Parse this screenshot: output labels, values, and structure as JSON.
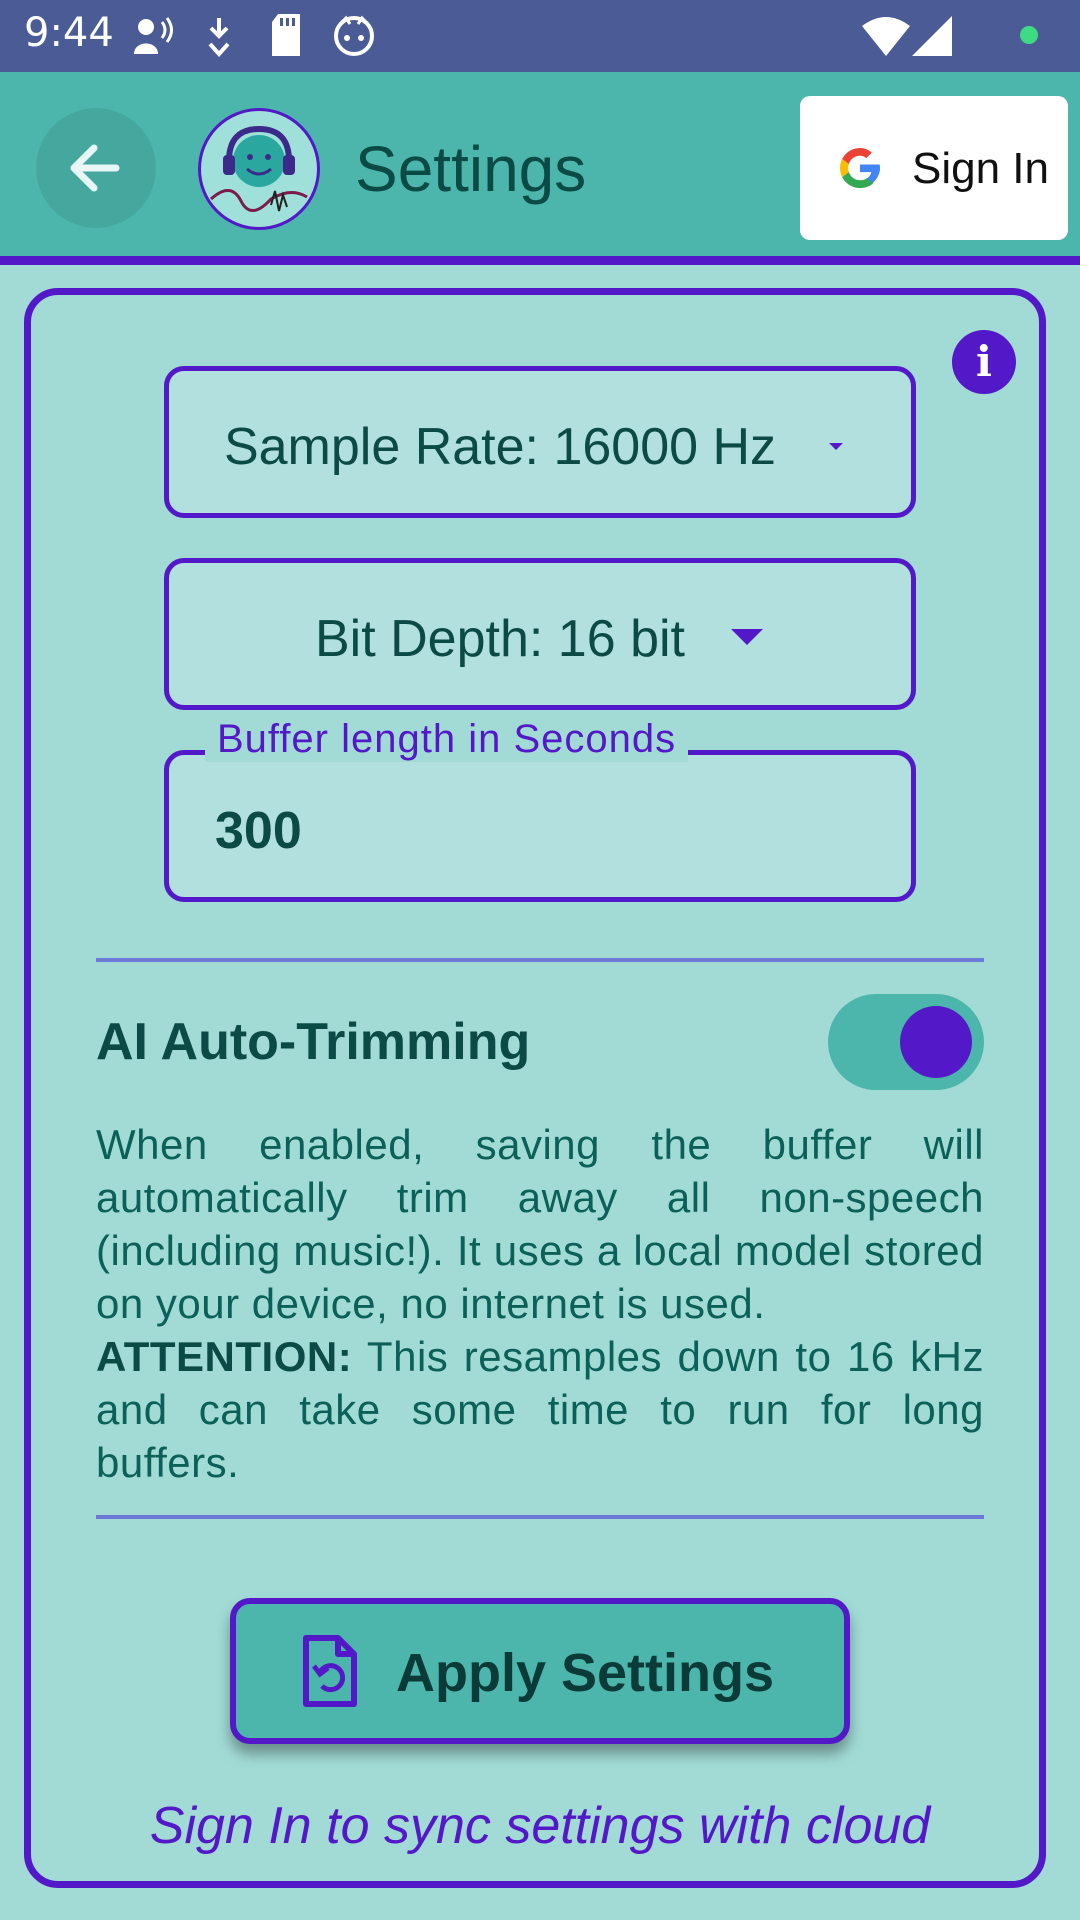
{
  "status_bar": {
    "time": "9:44"
  },
  "app_bar": {
    "title": "Settings",
    "sign_in_label": "Sign In"
  },
  "settings": {
    "sample_rate": "Sample Rate: 16000 Hz",
    "bit_depth": "Bit Depth: 16 bit",
    "buffer_label": "Buffer length in Seconds",
    "buffer_value": "300",
    "auto_trim_title": "AI Auto-Trimming",
    "auto_trim_enabled": true,
    "desc_part1": "When enabled, saving the buffer will automatically trim away all non-speech (including music!). It uses a local model stored on your device, no internet is used.",
    "attention_label": "ATTENTION:",
    "desc_part2": " This resamples down to 16 kHz and can take some time to run for long buffers.",
    "apply_label": "Apply Settings",
    "footer_note": "Sign In to sync settings with cloud"
  },
  "colors": {
    "accent": "#5318c7",
    "teal": "#4db6ac",
    "background": "#a2dbd6",
    "status_bar": "#4a5b95"
  },
  "icons": {
    "back": "arrow-left-icon",
    "info": "info-icon",
    "google": "google-g-icon",
    "apply": "file-restore-icon"
  }
}
